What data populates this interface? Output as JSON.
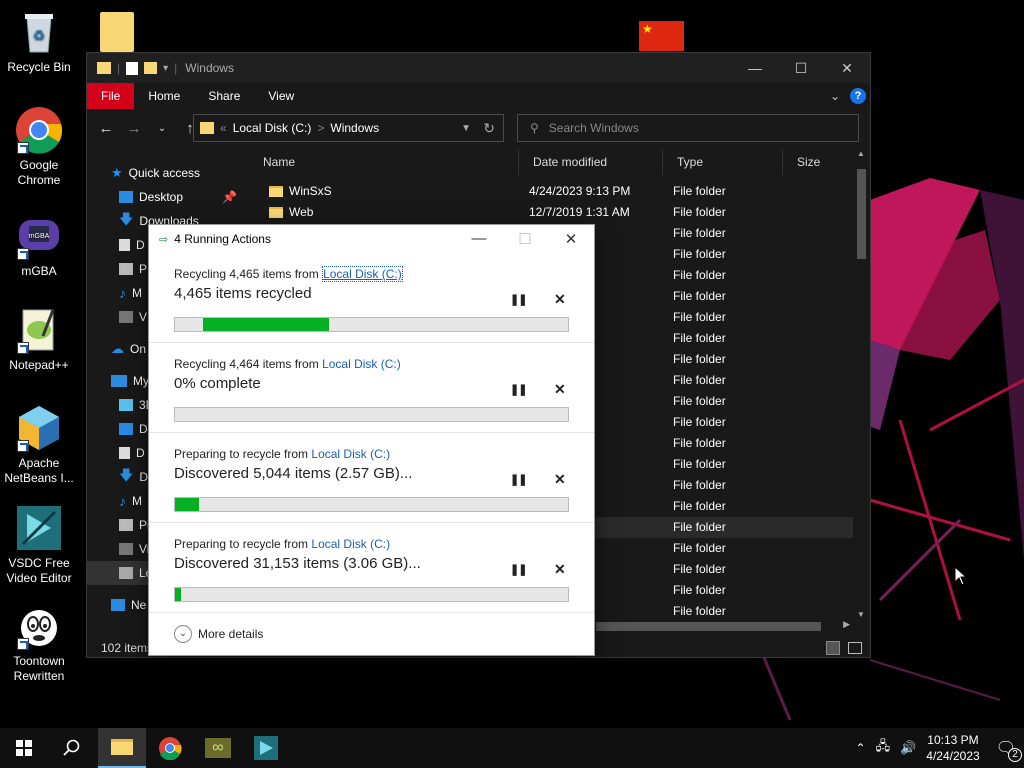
{
  "desktop": {
    "icons": [
      {
        "label": "Recycle Bin"
      },
      {
        "label": "Google Chrome"
      },
      {
        "label": "mGBA"
      },
      {
        "label": "Notepad++"
      },
      {
        "label": "Apache NetBeans I..."
      },
      {
        "label": "VSDC Free Video Editor"
      },
      {
        "label": "Toontown Rewritten"
      }
    ]
  },
  "explorer": {
    "title": "Windows",
    "ribbon_tabs": [
      "File",
      "Home",
      "Share",
      "View"
    ],
    "address": {
      "root": "Local Disk (C:)",
      "separator": ">",
      "current": "Windows",
      "prefix": "«"
    },
    "search_placeholder": "Search Windows",
    "nav": {
      "quick_access": "Quick access",
      "desktop": "Desktop",
      "downloads": "Downloads",
      "documents": "D",
      "pictures": "P",
      "music": "M",
      "videos": "V",
      "onedrive": "On",
      "this_pc": "My",
      "objects3d": "3D",
      "desktop2": "D",
      "documents2": "D",
      "downloads2": "D",
      "music2": "M",
      "pictures2": "Pi",
      "videos2": "Vi",
      "local_disk": "Lo",
      "network": "Ne"
    },
    "columns": {
      "name": "Name",
      "date": "Date modified",
      "type": "Type",
      "size": "Size"
    },
    "rows": [
      {
        "name": "WinSxS",
        "date": "4/24/2023 9:13 PM",
        "type": "File folder"
      },
      {
        "name": "Web",
        "date": "12/7/2019 1:31 AM",
        "type": "File folder"
      },
      {
        "name": "",
        "date": "4 AM",
        "type": "File folder"
      },
      {
        "name": "",
        "date": "4 AM",
        "type": "File folder"
      },
      {
        "name": "",
        "date": "PM",
        "type": "File folder"
      },
      {
        "name": "",
        "date": "4 AM",
        "type": "File folder"
      },
      {
        "name": "",
        "date": "06 PM",
        "type": "File folder"
      },
      {
        "name": "",
        "date": "4 PM",
        "type": "File folder"
      },
      {
        "name": "",
        "date": "4 AM",
        "type": "File folder"
      },
      {
        "name": "",
        "date": "3 PM",
        "type": "File folder"
      },
      {
        "name": "",
        "date": "PM",
        "type": "File folder"
      },
      {
        "name": "",
        "date": "4 PM",
        "type": "File folder"
      },
      {
        "name": "",
        "date": "4 PM",
        "type": "File folder"
      },
      {
        "name": "",
        "date": "5 PM",
        "type": "File folder"
      },
      {
        "name": "",
        "date": "4 AM",
        "type": "File folder"
      },
      {
        "name": "",
        "date": "4 AM",
        "type": "File folder"
      },
      {
        "name": "",
        "date": "4 AM",
        "type": "File folder"
      },
      {
        "name": "",
        "date": "22 AM",
        "type": "File folder"
      },
      {
        "name": "",
        "date": "1 AM",
        "type": "File folder"
      },
      {
        "name": "",
        "date": "PM",
        "type": "File folder"
      },
      {
        "name": "",
        "date": "PM",
        "type": "File folder"
      }
    ],
    "status": "102 items"
  },
  "dialog": {
    "title": "4 Running Actions",
    "actions": [
      {
        "line1_prefix": "Recycling 4,465 items from ",
        "link": "Local Disk (C:)",
        "line2": "4,465 items recycled",
        "progress": 0.32,
        "progress_start": 0.07
      },
      {
        "line1_prefix": "Recycling 4,464 items from ",
        "link": "Local Disk (C:)",
        "line2": "0% complete",
        "progress": 0.0,
        "progress_start": 0
      },
      {
        "line1_prefix": "Preparing to recycle from ",
        "link": "Local Disk (C:)",
        "line2": "Discovered 5,044 items (2.57 GB)...",
        "progress": 0.06,
        "progress_start": 0
      },
      {
        "line1_prefix": "Preparing to recycle from ",
        "link": "Local Disk (C:)",
        "line2": "Discovered 31,153 items (3.06 GB)...",
        "progress": 0.015,
        "progress_start": 0
      }
    ],
    "more_details": "More details"
  },
  "taskbar": {
    "time": "10:13 PM",
    "date": "4/24/2023",
    "notification_count": "2"
  },
  "colors": {
    "accent_file_tab": "#d4001a",
    "progress_green": "#06b025",
    "link_blue": "#1a5fb4"
  }
}
